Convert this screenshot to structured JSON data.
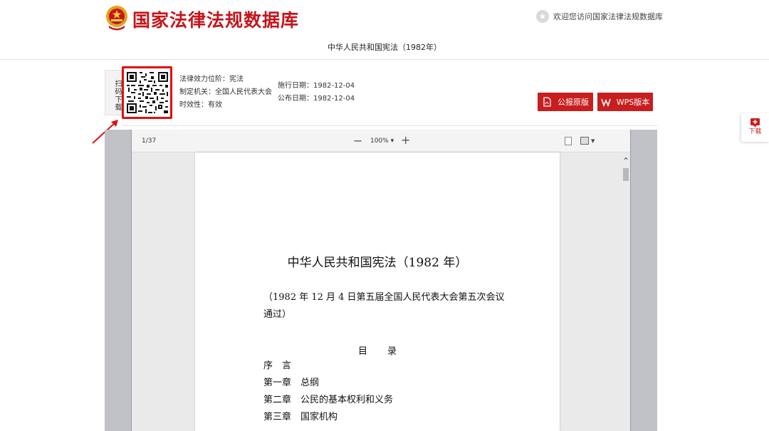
{
  "header": {
    "site_title": "国家法律法规数据库",
    "welcome_text": "欢迎您访问国家法律法规数据库"
  },
  "document": {
    "title": "中华人民共和国宪法（1982年）"
  },
  "info": {
    "scan_label": "扫码下载",
    "effect_level": "法律效力位阶：宪法",
    "enacting_body": "制定机关：全国人民代表大会",
    "validity": "时效性：有效",
    "effective_date": "施行日期：1982-12-04",
    "publish_date": "公布日期：1982-12-04"
  },
  "buttons": {
    "original_label": "公报原版",
    "wps_label": "WPS版本"
  },
  "viewer": {
    "page_indicator": "1/37",
    "zoom_level": "100%",
    "zoom_caret": "▾"
  },
  "pdf": {
    "title": "中华人民共和国宪法（1982 年）",
    "adoption_note": "（1982 年 12 月 4 日第五届全国人民代表大会第五次会议通过）",
    "toc_title": "目录",
    "toc_items": [
      "序　言",
      "第一章　总纲",
      "第二章　公民的基本权利和义务",
      "第三章　国家机构"
    ]
  },
  "side": {
    "download_label": "下载"
  },
  "colors": {
    "brand_red": "#c4161c",
    "button_red": "#c81e1e",
    "annotation_red": "#e01010"
  }
}
